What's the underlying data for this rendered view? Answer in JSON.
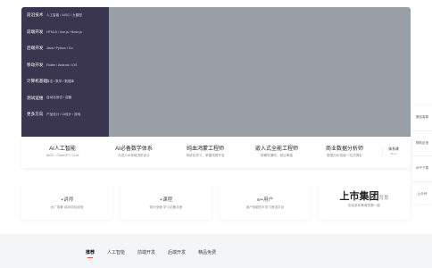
{
  "categories": [
    {
      "title": "前沿技术",
      "subs": "人工智能 / AIGC / 大模型"
    },
    {
      "title": "前端开发",
      "subs": "HTML5 / Vue.js / Node.js"
    },
    {
      "title": "后端开发",
      "subs": "Java / Python / Go"
    },
    {
      "title": "移动开发",
      "subs": "Flutter / Android / iOS"
    },
    {
      "title": "计算机基础",
      "subs": "算法 / 数学 / 数据库"
    },
    {
      "title": "测试运维",
      "subs": "自动化测试 / 容器"
    },
    {
      "title": "更多方向",
      "subs": "产品设计 / UI设计 / 游戏"
    }
  ],
  "courses": [
    {
      "name": "AI人工智能",
      "desc": "AIGC / ChatGPT / LLM"
    },
    {
      "name": "AI必备数学体系",
      "desc": "为进入AI领域进阶设计"
    },
    {
      "name": "纯血鸿蒙工程师",
      "desc": "系统化学习，掌握鸿蒙开发"
    },
    {
      "name": "嵌入式全能工程师",
      "desc": "软硬件通吃，就业率高"
    },
    {
      "name": "商业数据分析师",
      "desc": "数据分析技能一站式搞定"
    }
  ],
  "system_course": {
    "label": "体系课",
    "sub": "More"
  },
  "stats": [
    {
      "num": "",
      "plus": "+讲师",
      "desc": "大厂背景 成功项目经验"
    },
    {
      "num": "",
      "plus": "+课程",
      "desc": "知识全面 学习必备手册"
    },
    {
      "num": "",
      "plus": "w+用户",
      "desc": "用户信赖的IT学习首选平台"
    },
    {
      "num": "上市集团",
      "plus": "背景",
      "desc": "历经多年教育的第一股"
    }
  ],
  "side_panel": [
    "微信客服",
    "帮助反馈",
    "APP下载",
    "公众号"
  ],
  "tabs": [
    "推荐",
    "人工智能",
    "前端开发",
    "后端开发",
    "精品免费"
  ],
  "colors": {
    "menu_bg": "#3b3650",
    "banner": "#9a9ea6",
    "accent": "#e8522f"
  }
}
